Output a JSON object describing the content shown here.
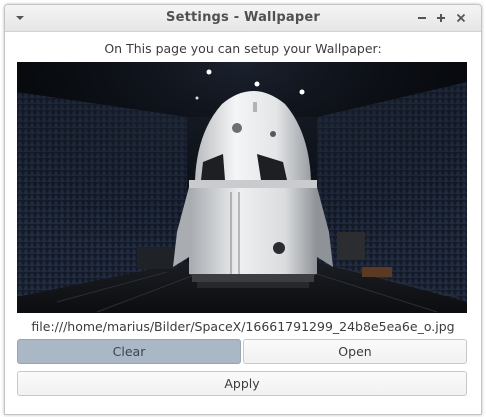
{
  "window": {
    "title": "Settings - Wallpaper"
  },
  "content": {
    "prompt": "On This page you can setup your Wallpaper:",
    "file_path": "file:///home/marius/Bilder/SpaceX/16661791299_24b8e5ea6e_o.jpg"
  },
  "buttons": {
    "clear_label": "Clear",
    "open_label": "Open",
    "apply_label": "Apply"
  },
  "colors": {
    "pressed_button": "#aab7c4",
    "titlebar": "#ececec"
  }
}
